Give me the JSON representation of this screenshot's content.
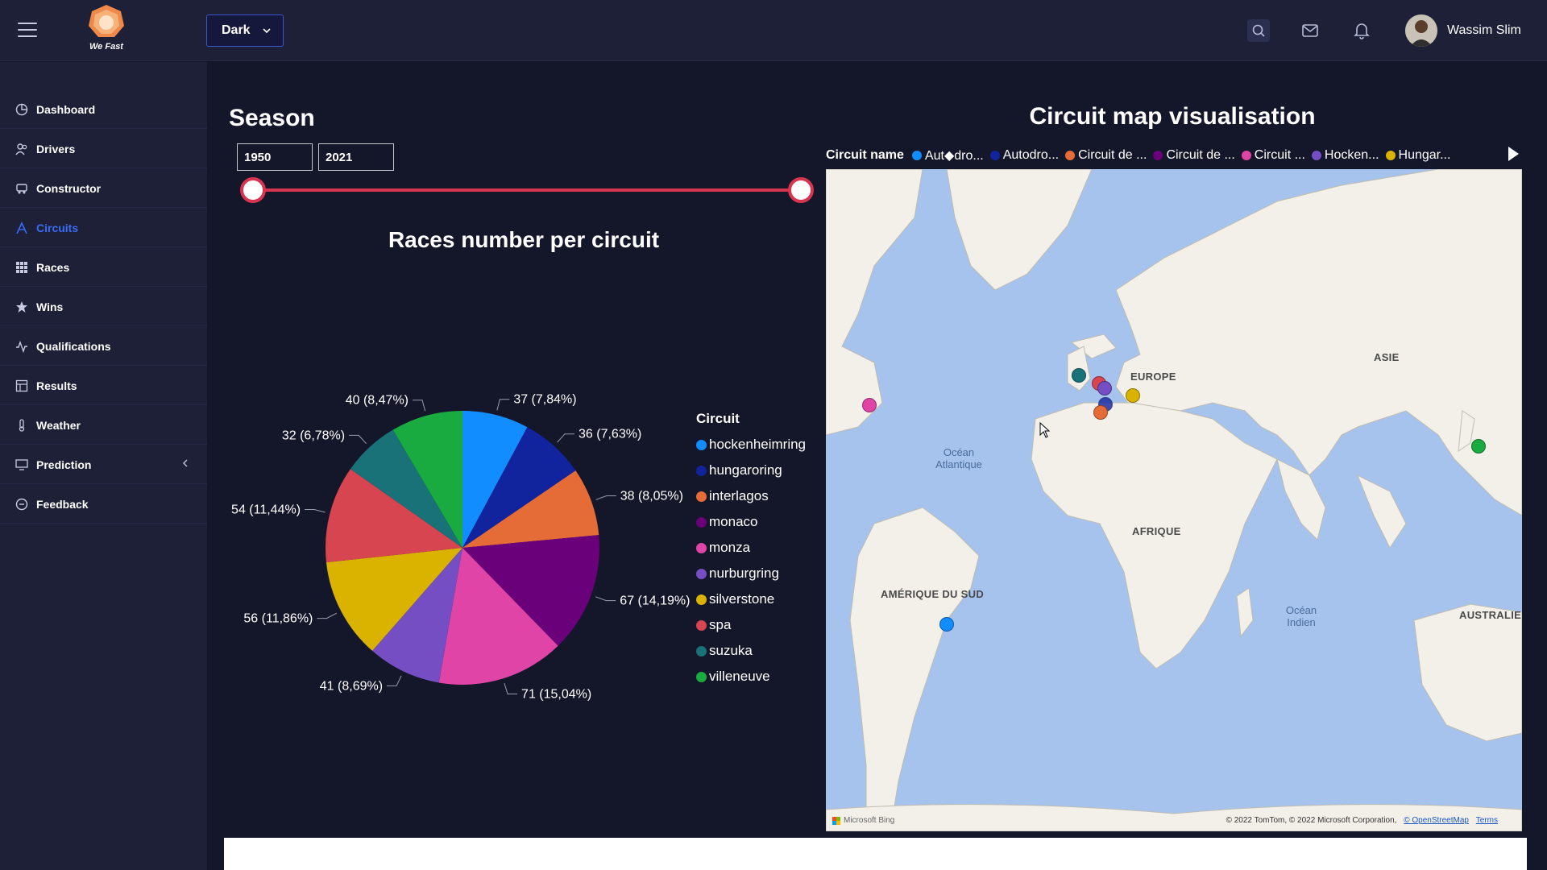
{
  "header": {
    "logo_text": "We Fast",
    "theme_select": "Dark",
    "user_name": "Wassim Slim"
  },
  "sidebar": {
    "items": [
      {
        "label": "Dashboard",
        "icon": "pie-icon"
      },
      {
        "label": "Drivers",
        "icon": "users-icon"
      },
      {
        "label": "Constructor",
        "icon": "car-icon"
      },
      {
        "label": "Circuits",
        "icon": "circuit-icon",
        "active": true
      },
      {
        "label": "Races",
        "icon": "grid-icon"
      },
      {
        "label": "Wins",
        "icon": "star-icon"
      },
      {
        "label": "Qualifications",
        "icon": "activity-icon"
      },
      {
        "label": "Results",
        "icon": "table-icon"
      },
      {
        "label": "Weather",
        "icon": "thermometer-icon"
      },
      {
        "label": "Prediction",
        "icon": "monitor-icon"
      },
      {
        "label": "Feedback",
        "icon": "feedback-icon"
      }
    ]
  },
  "season": {
    "title": "Season",
    "start": "1950",
    "end": "2021"
  },
  "pie_chart": {
    "title": "Races number per circuit",
    "legend_title": "Circuit"
  },
  "chart_data": {
    "type": "pie",
    "title": "Races number per circuit",
    "legend_title": "Circuit",
    "slices": [
      {
        "name": "hockenheimring",
        "value": 37,
        "label": "37 (7,84%)",
        "color": "#118dff"
      },
      {
        "name": "hungaroring",
        "value": 36,
        "label": "36 (7,63%)",
        "color": "#12239e"
      },
      {
        "name": "interlagos",
        "value": 38,
        "label": "38 (8,05%)",
        "color": "#e66c37"
      },
      {
        "name": "monaco",
        "value": 67,
        "label": "67 (14,19%)",
        "color": "#6b007b"
      },
      {
        "name": "monza",
        "value": 71,
        "label": "71 (15,04%)",
        "color": "#e044a7"
      },
      {
        "name": "nurburgring",
        "value": 41,
        "label": "41 (8,69%)",
        "color": "#744ec2"
      },
      {
        "name": "silverstone",
        "value": 56,
        "label": "56 (11,86%)",
        "color": "#d9b300"
      },
      {
        "name": "spa",
        "value": 54,
        "label": "54 (11,44%)",
        "color": "#d64550"
      },
      {
        "name": "suzuka",
        "value": 32,
        "label": "32 (6,78%)",
        "color": "#197278"
      },
      {
        "name": "villeneuve",
        "value": 40,
        "label": "40 (8,47%)",
        "color": "#1aab40"
      }
    ]
  },
  "map": {
    "title": "Circuit map visualisation",
    "legend_title": "Circuit name",
    "legend_items": [
      {
        "label": "Aut◆dro...",
        "color": "#118dff"
      },
      {
        "label": "Autodro...",
        "color": "#12239e"
      },
      {
        "label": "Circuit de ...",
        "color": "#e66c37"
      },
      {
        "label": "Circuit de ...",
        "color": "#6b007b"
      },
      {
        "label": "Circuit ...",
        "color": "#e044a7"
      },
      {
        "label": "Hocken...",
        "color": "#744ec2"
      },
      {
        "label": "Hungar...",
        "color": "#d9b300"
      }
    ],
    "regions": {
      "europe": "EUROPE",
      "asia": "ASIE",
      "africa": "AFRIQUE",
      "south_america": "AMÉRIQUE DU SUD",
      "australia": "AUSTRALIE",
      "atlantic_1": "Océan",
      "atlantic_2": "Atlantique",
      "indian_1": "Océan",
      "indian_2": "Indien"
    },
    "footer": {
      "copyright": "© 2022 TomTom, © 2022 Microsoft Corporation,",
      "osm": "© OpenStreetMap",
      "terms": "Terms",
      "bing": "Microsoft Bing"
    }
  }
}
